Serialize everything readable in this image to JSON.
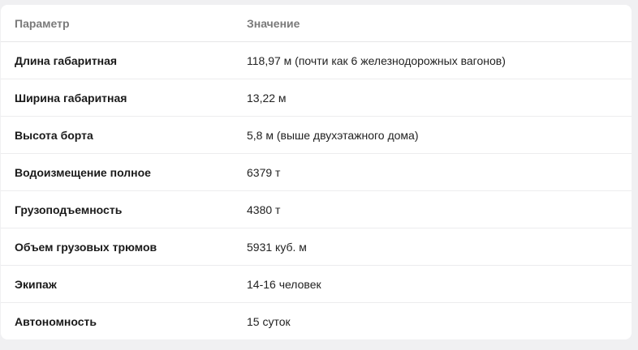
{
  "table": {
    "headers": {
      "param": "Параметр",
      "value": "Значение"
    },
    "rows": [
      {
        "param": "Длина габаритная",
        "value": "118,97 м (почти как 6 железнодорожных вагонов)"
      },
      {
        "param": "Ширина габаритная",
        "value": "13,22 м"
      },
      {
        "param": "Высота борта",
        "value": "5,8 м (выше двухэтажного дома)"
      },
      {
        "param": "Водоизмещение полное",
        "value": "6379 т"
      },
      {
        "param": "Грузоподъемность",
        "value": "4380 т"
      },
      {
        "param": "Объем грузовых трюмов",
        "value": "5931 куб. м"
      },
      {
        "param": "Экипаж",
        "value": "14-16 человек"
      },
      {
        "param": "Автономность",
        "value": "15 суток"
      }
    ]
  }
}
